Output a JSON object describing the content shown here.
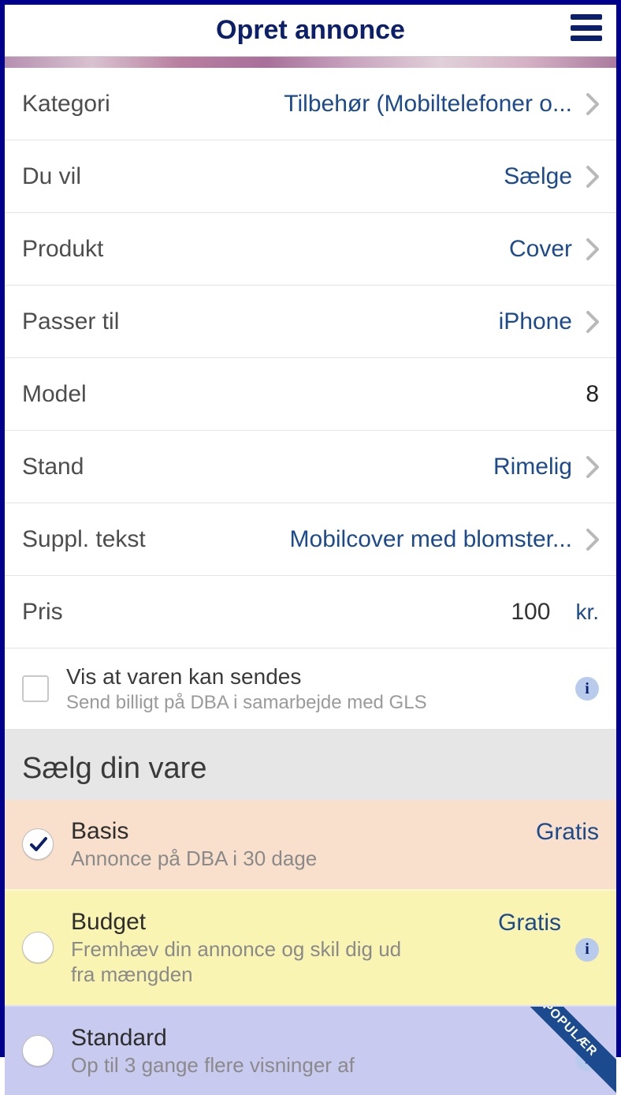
{
  "header": {
    "title": "Opret annonce"
  },
  "rows": {
    "kategori": {
      "label": "Kategori",
      "value": "Tilbehør (Mobiltelefoner o..."
    },
    "duvil": {
      "label": "Du vil",
      "value": "Sælge"
    },
    "produkt": {
      "label": "Produkt",
      "value": "Cover"
    },
    "passer": {
      "label": "Passer til",
      "value": "iPhone"
    },
    "model": {
      "label": "Model",
      "value": "8"
    },
    "stand": {
      "label": "Stand",
      "value": "Rimelig"
    },
    "suppl": {
      "label": "Suppl. tekst",
      "value": "Mobilcover med blomster..."
    },
    "pris": {
      "label": "Pris",
      "value": "100",
      "unit": "kr."
    }
  },
  "shipping": {
    "title": "Vis at varen kan sendes",
    "subtitle": "Send billigt på DBA i samarbejde med GLS"
  },
  "section_title": "Sælg din vare",
  "plans": {
    "basis": {
      "title": "Basis",
      "subtitle": "Annonce på DBA i 30 dage",
      "price": "Gratis"
    },
    "budget": {
      "title": "Budget",
      "subtitle": "Fremhæv din annonce og skil dig ud fra mængden",
      "price": "Gratis"
    },
    "standard": {
      "title": "Standard",
      "subtitle": "Op til 3 gange flere visninger af",
      "price": ""
    }
  },
  "popular_label": "POPULÆR"
}
